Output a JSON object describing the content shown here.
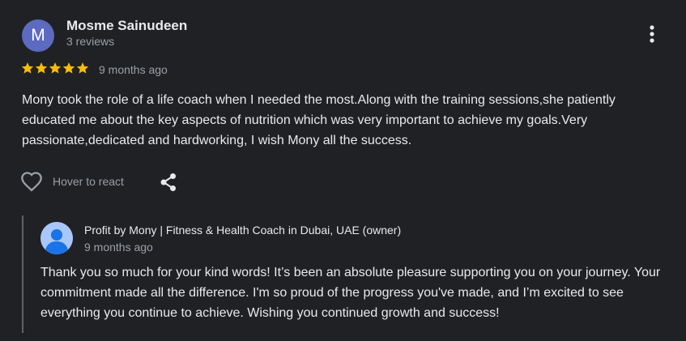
{
  "review": {
    "avatar_letter": "M",
    "avatar_color": "#5c6bc0",
    "reviewer_name": "Mosme Sainudeen",
    "review_count": "3 reviews",
    "rating": 5,
    "rating_max": 5,
    "star_color": "#fbbc04",
    "date": "9 months ago",
    "text": "Mony took the role of a life coach when I needed the most.Along with the training sessions,she patiently educated me about the key aspects of nutrition which was very important to achieve my goals.Very passionate,dedicated and hardworking, I wish Mony all the success.",
    "more_icon": "more-vert-icon"
  },
  "actions": {
    "react_icon": "heart-outline-icon",
    "react_label": "Hover to react",
    "share_icon": "share-icon"
  },
  "owner_reply": {
    "avatar_icon": "default-profile-icon",
    "avatar_color": "#a8c7fa",
    "owner_name": "Profit by Mony | Fitness & Health Coach in Dubai, UAE (owner)",
    "date": "9 months ago",
    "text": "Thank you so much for your kind words! It’s been an absolute pleasure supporting you on your journey. Your commitment made all the difference. I'm so proud of the progress you've made, and I’m excited to see everything you continue to achieve. Wishing you continued growth and success!"
  }
}
